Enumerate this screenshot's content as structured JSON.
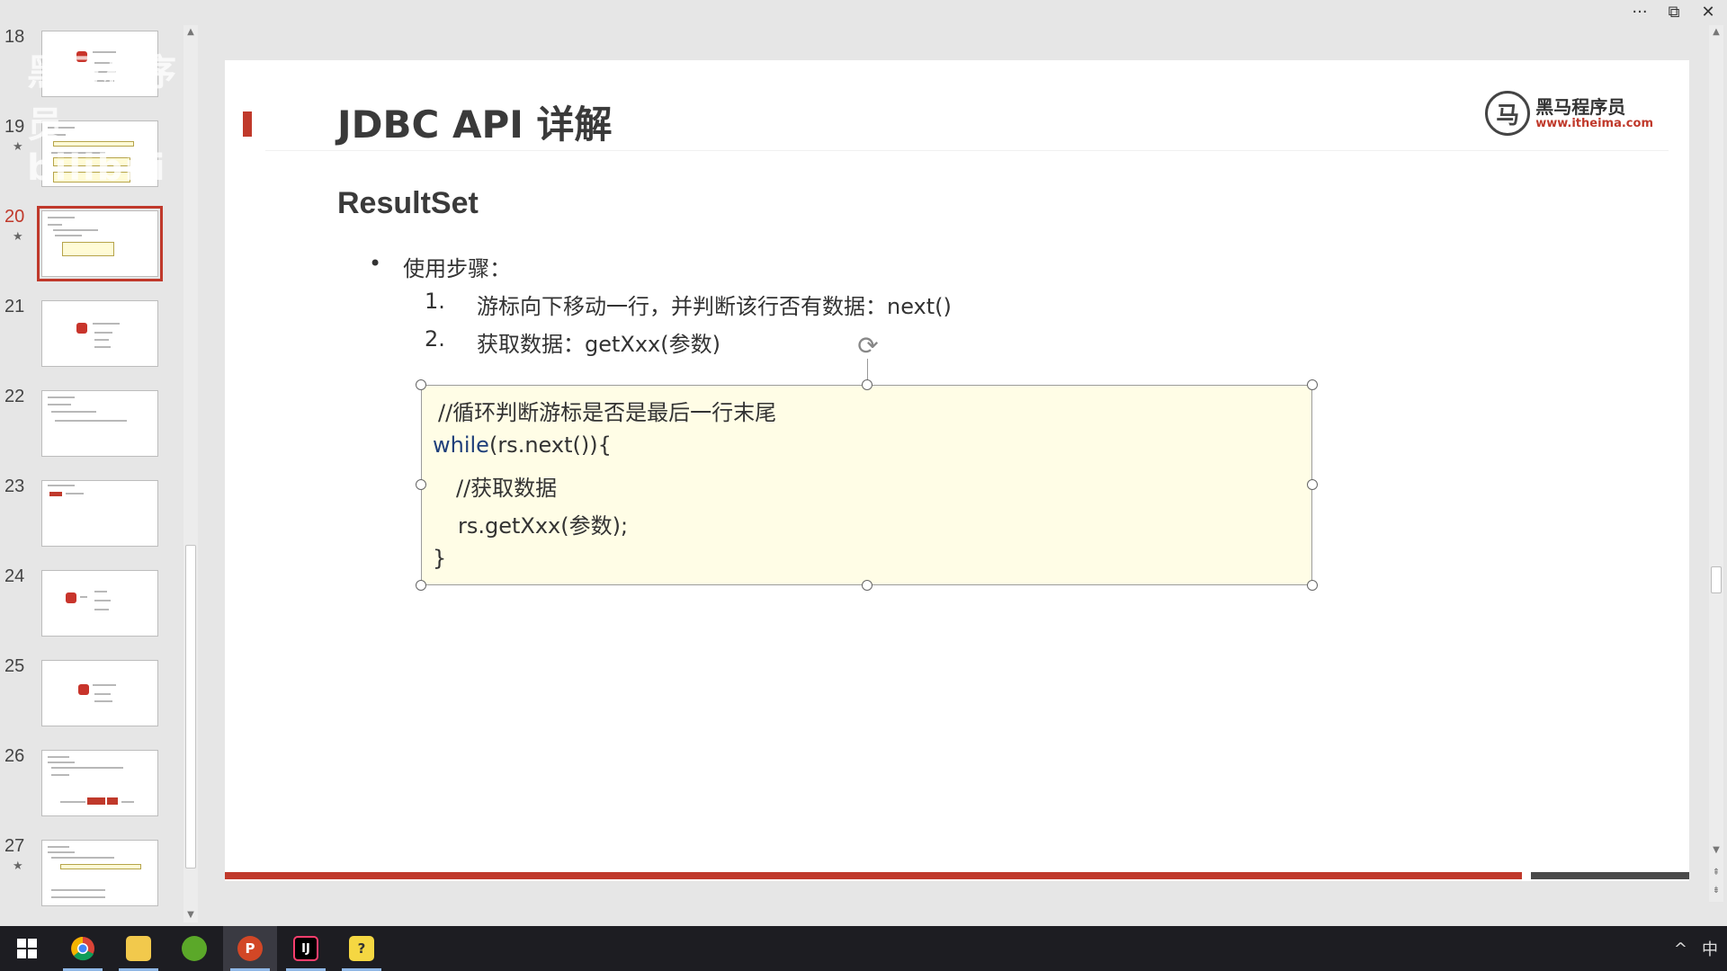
{
  "thumbnails": [
    {
      "number": "18",
      "starred": false,
      "active": false
    },
    {
      "number": "19",
      "starred": true,
      "active": false
    },
    {
      "number": "20",
      "starred": true,
      "active": true
    },
    {
      "number": "21",
      "starred": false,
      "active": false
    },
    {
      "number": "22",
      "starred": false,
      "active": false
    },
    {
      "number": "23",
      "starred": false,
      "active": false
    },
    {
      "number": "24",
      "starred": false,
      "active": false
    },
    {
      "number": "25",
      "starred": false,
      "active": false
    },
    {
      "number": "26",
      "starred": false,
      "active": false
    },
    {
      "number": "27",
      "starred": true,
      "active": false
    }
  ],
  "watermark": "黑马程序员 bilibili",
  "star_glyph": "★",
  "window_controls": {
    "more": "···",
    "restore": "⧉",
    "close": "✕"
  },
  "slide": {
    "title": "JDBC API 详解",
    "logo_cn": "黑马程序员",
    "logo_url": "www.itheima.com",
    "section_title": "ResultSet",
    "bullet_marker": "•",
    "bullet_text": "使用步骤：",
    "steps": [
      {
        "num": "1.",
        "text": "游标向下移动一行，并判断该行否有数据：next()"
      },
      {
        "num": "2.",
        "text": "获取数据：getXxx(参数)"
      }
    ],
    "code": {
      "line1": "//循环判断游标是否是最后一行末尾",
      "line2_kw": "while",
      "line2_rest": "(rs.next()){",
      "line3": "//获取数据",
      "line4": "rs.getXxx(参数);",
      "line5": "}"
    }
  },
  "taskbar": {
    "apps": [
      "start",
      "chrome",
      "file-explorer",
      "evernote",
      "powerpoint",
      "intellij",
      "notes"
    ],
    "active_app": "powerpoint",
    "tray_chevron": "^",
    "ime_indicator": "中"
  },
  "colors": {
    "accent_red": "#c0392b",
    "code_bg": "#fffde6",
    "taskbar_bg": "#1d1d22"
  }
}
